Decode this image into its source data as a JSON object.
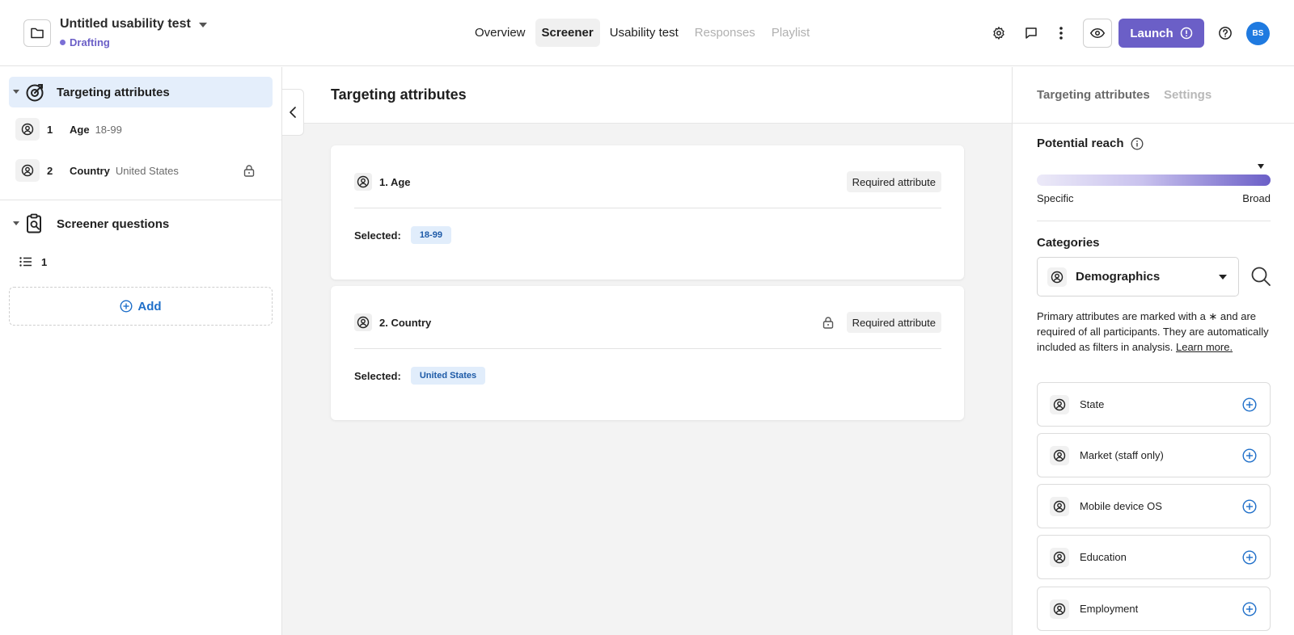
{
  "header": {
    "title": "Untitled usability test",
    "status": "Drafting",
    "tabs": [
      {
        "label": "Overview",
        "state": "normal"
      },
      {
        "label": "Screener",
        "state": "active"
      },
      {
        "label": "Usability test",
        "state": "normal"
      },
      {
        "label": "Responses",
        "state": "disabled"
      },
      {
        "label": "Playlist",
        "state": "disabled"
      }
    ],
    "launch_label": "Launch",
    "avatar_initials": "BS"
  },
  "sidebar": {
    "targeting_label": "Targeting attributes",
    "attributes": [
      {
        "num": "1",
        "name": "Age",
        "value": "18-99",
        "locked": false
      },
      {
        "num": "2",
        "name": "Country",
        "value": "United States",
        "locked": true
      }
    ],
    "screener_label": "Screener questions",
    "questions": [
      {
        "num": "1"
      }
    ],
    "add_label": "Add"
  },
  "main": {
    "title": "Targeting attributes",
    "cards": [
      {
        "title": "1. Age",
        "badge": "Required attribute",
        "selected_label": "Selected:",
        "selected_value": "18-99",
        "locked": false
      },
      {
        "title": "2. Country",
        "badge": "Required attribute",
        "selected_label": "Selected:",
        "selected_value": "United States",
        "locked": true
      }
    ]
  },
  "right_panel": {
    "tabs": [
      "Targeting attributes",
      "Settings"
    ],
    "potential_reach": {
      "title": "Potential reach",
      "min_label": "Specific",
      "max_label": "Broad",
      "marker_position": 0.96
    },
    "categories": {
      "title": "Categories",
      "selected": "Demographics",
      "description": "Primary attributes are marked with a ∗ and are required of all participants. They are automatically included as filters in analysis.",
      "learn_more": "Learn more."
    },
    "options": [
      "State",
      "Market (staff only)",
      "Mobile device OS",
      "Education",
      "Employment"
    ]
  },
  "colors": {
    "accent_purple": "#6b5fc7",
    "drafting_dot": "#7b6fd6",
    "link_blue": "#1f6fc9",
    "avatar_blue": "#1f7ae0",
    "chip_bg": "#e1edfb",
    "chip_text": "#1d5aa7"
  },
  "icons": {
    "folder": "folder-icon",
    "gear": "gear-icon",
    "comment": "comment-icon",
    "more": "more-vertical-icon",
    "preview": "eye-icon",
    "help": "help-circle-icon",
    "targeting": "target-icon",
    "screener": "clipboard-search-icon",
    "attribute": "person-badge-icon",
    "lock": "lock-icon",
    "list": "list-icon",
    "add": "plus-circle-icon",
    "search": "search-icon",
    "info": "info-icon"
  }
}
